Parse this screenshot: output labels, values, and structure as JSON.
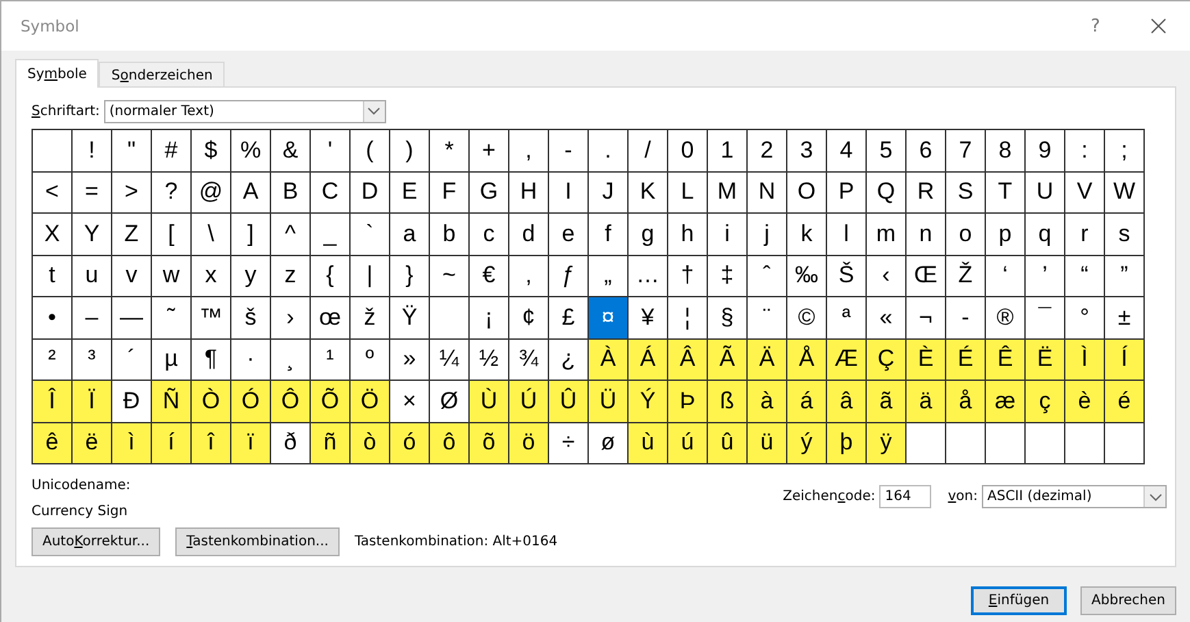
{
  "window": {
    "title": "Symbol",
    "help": "?"
  },
  "tabs": [
    {
      "label": {
        "pre": "Sy",
        "key": "m",
        "post": "bole"
      },
      "selected": true
    },
    {
      "label": {
        "pre": "S",
        "key": "o",
        "post": "nderzeichen"
      },
      "selected": false
    }
  ],
  "font": {
    "label": {
      "key": "S",
      "post": "chriftart:"
    },
    "value": "(normaler Text)"
  },
  "grid": {
    "rows": [
      [
        {
          "highlighted": false,
          "selected": false
        },
        {
          "char": "!",
          "highlighted": false,
          "selected": false
        },
        {
          "char": "\"",
          "highlighted": false,
          "selected": false
        },
        {
          "char": "#",
          "highlighted": false,
          "selected": false
        },
        {
          "char": "$",
          "highlighted": false,
          "selected": false
        },
        {
          "char": "%",
          "highlighted": false,
          "selected": false
        },
        {
          "char": "&",
          "highlighted": false,
          "selected": false
        },
        {
          "char": "'",
          "highlighted": false,
          "selected": false
        },
        {
          "char": "(",
          "highlighted": false,
          "selected": false
        },
        {
          "char": ")",
          "highlighted": false,
          "selected": false
        },
        {
          "char": "*",
          "highlighted": false,
          "selected": false
        },
        {
          "char": "+",
          "highlighted": false,
          "selected": false
        },
        {
          "char": ",",
          "highlighted": false,
          "selected": false
        },
        {
          "char": "-",
          "highlighted": false,
          "selected": false
        },
        {
          "char": ".",
          "highlighted": false,
          "selected": false
        },
        {
          "char": "/",
          "highlighted": false,
          "selected": false
        },
        {
          "char": "0",
          "highlighted": false,
          "selected": false
        },
        {
          "char": "1",
          "highlighted": false,
          "selected": false
        },
        {
          "char": "2",
          "highlighted": false,
          "selected": false
        },
        {
          "char": "3",
          "highlighted": false,
          "selected": false
        },
        {
          "char": "4",
          "highlighted": false,
          "selected": false
        },
        {
          "char": "5",
          "highlighted": false,
          "selected": false
        },
        {
          "char": "6",
          "highlighted": false,
          "selected": false
        },
        {
          "char": "7",
          "highlighted": false,
          "selected": false
        },
        {
          "char": "8",
          "highlighted": false,
          "selected": false
        },
        {
          "char": "9",
          "highlighted": false,
          "selected": false
        },
        {
          "char": ":",
          "highlighted": false,
          "selected": false
        },
        {
          "char": ";",
          "highlighted": false,
          "selected": false
        }
      ],
      [
        {
          "char": "<",
          "highlighted": false,
          "selected": false
        },
        {
          "char": "=",
          "highlighted": false,
          "selected": false
        },
        {
          "char": ">",
          "highlighted": false,
          "selected": false
        },
        {
          "char": "?",
          "highlighted": false,
          "selected": false
        },
        {
          "char": "@",
          "highlighted": false,
          "selected": false
        },
        {
          "char": "A",
          "highlighted": false,
          "selected": false
        },
        {
          "char": "B",
          "highlighted": false,
          "selected": false
        },
        {
          "char": "C",
          "highlighted": false,
          "selected": false
        },
        {
          "char": "D",
          "highlighted": false,
          "selected": false
        },
        {
          "char": "E",
          "highlighted": false,
          "selected": false
        },
        {
          "char": "F",
          "highlighted": false,
          "selected": false
        },
        {
          "char": "G",
          "highlighted": false,
          "selected": false
        },
        {
          "char": "H",
          "highlighted": false,
          "selected": false
        },
        {
          "char": "I",
          "highlighted": false,
          "selected": false
        },
        {
          "char": "J",
          "highlighted": false,
          "selected": false
        },
        {
          "char": "K",
          "highlighted": false,
          "selected": false
        },
        {
          "char": "L",
          "highlighted": false,
          "selected": false
        },
        {
          "char": "M",
          "highlighted": false,
          "selected": false
        },
        {
          "char": "N",
          "highlighted": false,
          "selected": false
        },
        {
          "char": "O",
          "highlighted": false,
          "selected": false
        },
        {
          "char": "P",
          "highlighted": false,
          "selected": false
        },
        {
          "char": "Q",
          "highlighted": false,
          "selected": false
        },
        {
          "char": "R",
          "highlighted": false,
          "selected": false
        },
        {
          "char": "S",
          "highlighted": false,
          "selected": false
        },
        {
          "char": "T",
          "highlighted": false,
          "selected": false
        },
        {
          "char": "U",
          "highlighted": false,
          "selected": false
        },
        {
          "char": "V",
          "highlighted": false,
          "selected": false
        },
        {
          "char": "W",
          "highlighted": false,
          "selected": false
        }
      ],
      [
        {
          "char": "X",
          "highlighted": false,
          "selected": false
        },
        {
          "char": "Y",
          "highlighted": false,
          "selected": false
        },
        {
          "char": "Z",
          "highlighted": false,
          "selected": false
        },
        {
          "char": "[",
          "highlighted": false,
          "selected": false
        },
        {
          "char": "\\",
          "highlighted": false,
          "selected": false
        },
        {
          "char": "]",
          "highlighted": false,
          "selected": false
        },
        {
          "char": "^",
          "highlighted": false,
          "selected": false
        },
        {
          "char": "_",
          "highlighted": false,
          "selected": false
        },
        {
          "char": "`",
          "highlighted": false,
          "selected": false
        },
        {
          "char": "a",
          "highlighted": false,
          "selected": false
        },
        {
          "char": "b",
          "highlighted": false,
          "selected": false
        },
        {
          "char": "c",
          "highlighted": false,
          "selected": false
        },
        {
          "char": "d",
          "highlighted": false,
          "selected": false
        },
        {
          "char": "e",
          "highlighted": false,
          "selected": false
        },
        {
          "char": "f",
          "highlighted": false,
          "selected": false
        },
        {
          "char": "g",
          "highlighted": false,
          "selected": false
        },
        {
          "char": "h",
          "highlighted": false,
          "selected": false
        },
        {
          "char": "i",
          "highlighted": false,
          "selected": false
        },
        {
          "char": "j",
          "highlighted": false,
          "selected": false
        },
        {
          "char": "k",
          "highlighted": false,
          "selected": false
        },
        {
          "char": "l",
          "highlighted": false,
          "selected": false
        },
        {
          "char": "m",
          "highlighted": false,
          "selected": false
        },
        {
          "char": "n",
          "highlighted": false,
          "selected": false
        },
        {
          "char": "o",
          "highlighted": false,
          "selected": false
        },
        {
          "char": "p",
          "highlighted": false,
          "selected": false
        },
        {
          "char": "q",
          "highlighted": false,
          "selected": false
        },
        {
          "char": "r",
          "highlighted": false,
          "selected": false
        },
        {
          "char": "s",
          "highlighted": false,
          "selected": false
        }
      ],
      [
        {
          "char": "t",
          "highlighted": false,
          "selected": false
        },
        {
          "char": "u",
          "highlighted": false,
          "selected": false
        },
        {
          "char": "v",
          "highlighted": false,
          "selected": false
        },
        {
          "char": "w",
          "highlighted": false,
          "selected": false
        },
        {
          "char": "x",
          "highlighted": false,
          "selected": false
        },
        {
          "char": "y",
          "highlighted": false,
          "selected": false
        },
        {
          "char": "z",
          "highlighted": false,
          "selected": false
        },
        {
          "char": "{",
          "highlighted": false,
          "selected": false
        },
        {
          "char": "|",
          "highlighted": false,
          "selected": false
        },
        {
          "char": "}",
          "highlighted": false,
          "selected": false
        },
        {
          "char": "~",
          "highlighted": false,
          "selected": false
        },
        {
          "char": "€",
          "highlighted": false,
          "selected": false
        },
        {
          "char": "‚",
          "highlighted": false,
          "selected": false
        },
        {
          "char": "ƒ",
          "highlighted": false,
          "selected": false
        },
        {
          "char": "„",
          "highlighted": false,
          "selected": false
        },
        {
          "char": "…",
          "highlighted": false,
          "selected": false
        },
        {
          "char": "†",
          "highlighted": false,
          "selected": false
        },
        {
          "char": "‡",
          "highlighted": false,
          "selected": false
        },
        {
          "char": "ˆ",
          "highlighted": false,
          "selected": false
        },
        {
          "char": "‰",
          "highlighted": false,
          "selected": false
        },
        {
          "char": "Š",
          "highlighted": false,
          "selected": false
        },
        {
          "char": "‹",
          "highlighted": false,
          "selected": false
        },
        {
          "char": "Œ",
          "highlighted": false,
          "selected": false
        },
        {
          "char": "Ž",
          "highlighted": false,
          "selected": false
        },
        {
          "char": "‘",
          "highlighted": false,
          "selected": false
        },
        {
          "char": "’",
          "highlighted": false,
          "selected": false
        },
        {
          "char": "“",
          "highlighted": false,
          "selected": false
        },
        {
          "char": "”",
          "highlighted": false,
          "selected": false
        }
      ],
      [
        {
          "char": "•",
          "highlighted": false,
          "selected": false
        },
        {
          "char": "–",
          "highlighted": false,
          "selected": false
        },
        {
          "char": "—",
          "highlighted": false,
          "selected": false
        },
        {
          "char": "˜",
          "highlighted": false,
          "selected": false
        },
        {
          "char": "™",
          "highlighted": false,
          "selected": false
        },
        {
          "char": "š",
          "highlighted": false,
          "selected": false
        },
        {
          "char": "›",
          "highlighted": false,
          "selected": false
        },
        {
          "char": "œ",
          "highlighted": false,
          "selected": false
        },
        {
          "char": "ž",
          "highlighted": false,
          "selected": false
        },
        {
          "char": "Ÿ",
          "highlighted": false,
          "selected": false
        },
        {
          "highlighted": false,
          "selected": false
        },
        {
          "char": "¡",
          "highlighted": false,
          "selected": false
        },
        {
          "char": "¢",
          "highlighted": false,
          "selected": false
        },
        {
          "char": "£",
          "highlighted": false,
          "selected": false
        },
        {
          "char": "¤",
          "highlighted": false,
          "selected": true
        },
        {
          "char": "¥",
          "highlighted": false,
          "selected": false
        },
        {
          "char": "¦",
          "highlighted": false,
          "selected": false
        },
        {
          "char": "§",
          "highlighted": false,
          "selected": false
        },
        {
          "char": "¨",
          "highlighted": false,
          "selected": false
        },
        {
          "char": "©",
          "highlighted": false,
          "selected": false
        },
        {
          "char": "ª",
          "highlighted": false,
          "selected": false
        },
        {
          "char": "«",
          "highlighted": false,
          "selected": false
        },
        {
          "char": "¬",
          "highlighted": false,
          "selected": false
        },
        {
          "char": "-",
          "highlighted": false,
          "selected": false
        },
        {
          "char": "®",
          "highlighted": false,
          "selected": false
        },
        {
          "char": "¯",
          "highlighted": false,
          "selected": false
        },
        {
          "char": "°",
          "highlighted": false,
          "selected": false
        },
        {
          "char": "±",
          "highlighted": false,
          "selected": false
        }
      ],
      [
        {
          "char": "²",
          "highlighted": false,
          "selected": false
        },
        {
          "char": "³",
          "highlighted": false,
          "selected": false
        },
        {
          "char": "´",
          "highlighted": false,
          "selected": false
        },
        {
          "char": "µ",
          "highlighted": false,
          "selected": false
        },
        {
          "char": "¶",
          "highlighted": false,
          "selected": false
        },
        {
          "char": "·",
          "highlighted": false,
          "selected": false
        },
        {
          "char": "¸",
          "highlighted": false,
          "selected": false
        },
        {
          "char": "¹",
          "highlighted": false,
          "selected": false
        },
        {
          "char": "º",
          "highlighted": false,
          "selected": false
        },
        {
          "char": "»",
          "highlighted": false,
          "selected": false
        },
        {
          "char": "¼",
          "highlighted": false,
          "selected": false
        },
        {
          "char": "½",
          "highlighted": false,
          "selected": false
        },
        {
          "char": "¾",
          "highlighted": false,
          "selected": false
        },
        {
          "char": "¿",
          "highlighted": false,
          "selected": false
        },
        {
          "char": "À",
          "highlighted": true,
          "selected": false
        },
        {
          "char": "Á",
          "highlighted": true,
          "selected": false
        },
        {
          "char": "Â",
          "highlighted": true,
          "selected": false
        },
        {
          "char": "Ã",
          "highlighted": true,
          "selected": false
        },
        {
          "char": "Ä",
          "highlighted": true,
          "selected": false
        },
        {
          "char": "Å",
          "highlighted": true,
          "selected": false
        },
        {
          "char": "Æ",
          "highlighted": true,
          "selected": false
        },
        {
          "char": "Ç",
          "highlighted": true,
          "selected": false
        },
        {
          "char": "È",
          "highlighted": true,
          "selected": false
        },
        {
          "char": "É",
          "highlighted": true,
          "selected": false
        },
        {
          "char": "Ê",
          "highlighted": true,
          "selected": false
        },
        {
          "char": "Ë",
          "highlighted": true,
          "selected": false
        },
        {
          "char": "Ì",
          "highlighted": true,
          "selected": false
        },
        {
          "char": "Í",
          "highlighted": true,
          "selected": false
        }
      ],
      [
        {
          "char": "Î",
          "highlighted": true,
          "selected": false
        },
        {
          "char": "Ï",
          "highlighted": true,
          "selected": false
        },
        {
          "char": "Ð",
          "highlighted": false,
          "selected": false
        },
        {
          "char": "Ñ",
          "highlighted": true,
          "selected": false
        },
        {
          "char": "Ò",
          "highlighted": true,
          "selected": false
        },
        {
          "char": "Ó",
          "highlighted": true,
          "selected": false
        },
        {
          "char": "Ô",
          "highlighted": true,
          "selected": false
        },
        {
          "char": "Õ",
          "highlighted": true,
          "selected": false
        },
        {
          "char": "Ö",
          "highlighted": true,
          "selected": false
        },
        {
          "char": "×",
          "highlighted": false,
          "selected": false
        },
        {
          "char": "Ø",
          "highlighted": false,
          "selected": false
        },
        {
          "char": "Ù",
          "highlighted": true,
          "selected": false
        },
        {
          "char": "Ú",
          "highlighted": true,
          "selected": false
        },
        {
          "char": "Û",
          "highlighted": true,
          "selected": false
        },
        {
          "char": "Ü",
          "highlighted": true,
          "selected": false
        },
        {
          "char": "Ý",
          "highlighted": true,
          "selected": false
        },
        {
          "char": "Þ",
          "highlighted": true,
          "selected": false
        },
        {
          "char": "ß",
          "highlighted": true,
          "selected": false
        },
        {
          "char": "à",
          "highlighted": true,
          "selected": false
        },
        {
          "char": "á",
          "highlighted": true,
          "selected": false
        },
        {
          "char": "â",
          "highlighted": true,
          "selected": false
        },
        {
          "char": "ã",
          "highlighted": true,
          "selected": false
        },
        {
          "char": "ä",
          "highlighted": true,
          "selected": false
        },
        {
          "char": "å",
          "highlighted": true,
          "selected": false
        },
        {
          "char": "æ",
          "highlighted": true,
          "selected": false
        },
        {
          "char": "ç",
          "highlighted": true,
          "selected": false
        },
        {
          "char": "è",
          "highlighted": true,
          "selected": false
        },
        {
          "char": "é",
          "highlighted": true,
          "selected": false
        }
      ],
      [
        {
          "char": "ê",
          "highlighted": true,
          "selected": false
        },
        {
          "char": "ë",
          "highlighted": true,
          "selected": false
        },
        {
          "char": "ì",
          "highlighted": true,
          "selected": false
        },
        {
          "char": "í",
          "highlighted": true,
          "selected": false
        },
        {
          "char": "î",
          "highlighted": true,
          "selected": false
        },
        {
          "char": "ï",
          "highlighted": true,
          "selected": false
        },
        {
          "char": "ð",
          "highlighted": false,
          "selected": false
        },
        {
          "char": "ñ",
          "highlighted": true,
          "selected": false
        },
        {
          "char": "ò",
          "highlighted": true,
          "selected": false
        },
        {
          "char": "ó",
          "highlighted": true,
          "selected": false
        },
        {
          "char": "ô",
          "highlighted": true,
          "selected": false
        },
        {
          "char": "õ",
          "highlighted": true,
          "selected": false
        },
        {
          "char": "ö",
          "highlighted": true,
          "selected": false
        },
        {
          "char": "÷",
          "highlighted": false,
          "selected": false
        },
        {
          "char": "ø",
          "highlighted": false,
          "selected": false
        },
        {
          "char": "ù",
          "highlighted": true,
          "selected": false
        },
        {
          "char": "ú",
          "highlighted": true,
          "selected": false
        },
        {
          "char": "û",
          "highlighted": true,
          "selected": false
        },
        {
          "char": "ü",
          "highlighted": true,
          "selected": false
        },
        {
          "char": "ý",
          "highlighted": true,
          "selected": false
        },
        {
          "char": "þ",
          "highlighted": true,
          "selected": false
        },
        {
          "char": "ÿ",
          "highlighted": true,
          "selected": false
        }
      ]
    ]
  },
  "unicode_name": {
    "label": "Unicodename:",
    "value": "Currency Sign"
  },
  "buttons_left": [
    {
      "label": {
        "pre": "Auto",
        "key": "K",
        "post": "orrektur..."
      }
    },
    {
      "label": {
        "key": "T",
        "post": "astenkombination..."
      }
    }
  ],
  "shortcut_text": "Tastenkombination: Alt+0164",
  "char_code": {
    "label": {
      "pre": "Zeichen",
      "key": "c",
      "post": "ode:"
    },
    "value": "164"
  },
  "from": {
    "label": {
      "key": "v",
      "post": "on:"
    },
    "value": "ASCII (dezimal)"
  },
  "footer_buttons": [
    {
      "label": {
        "key": "E",
        "post": "infügen"
      },
      "default": true
    },
    {
      "label": {
        "pre": "Abbrechen"
      },
      "default": false
    }
  ]
}
